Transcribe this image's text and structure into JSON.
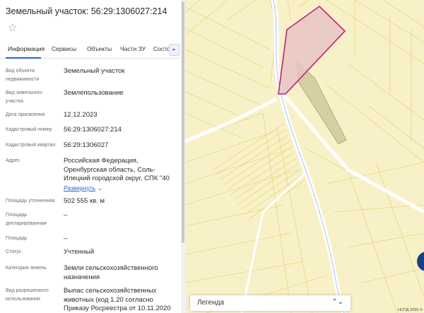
{
  "panel": {
    "title": "Земельный участок: 56:29:1306027:214",
    "star_icon": "☆",
    "tabs": [
      {
        "label": "Информация",
        "active": true
      },
      {
        "label": "Сервисы"
      },
      {
        "label": "Объекты"
      },
      {
        "label": "Части ЗУ"
      },
      {
        "label": "Состо"
      }
    ],
    "tab_scroll_icon": "▸",
    "rows": [
      {
        "label": "Вид объекта недвижимости",
        "value": "Земельный участок"
      },
      {
        "label": "Вид земельного участка",
        "value": "Землепользование"
      },
      {
        "label": "Дата присвоения",
        "value": "12.12.2023"
      },
      {
        "label": "Кадастровый номер",
        "value": "56:29:1306027:214"
      },
      {
        "label": "Кадастровый квартал",
        "value": "56:29:1306027"
      },
      {
        "label": "Адрес",
        "value": "Российская Федерация, Оренбургская область, Соль-Илецкий городской округ, СПК \"40",
        "link": "Развернуть"
      },
      {
        "label": "Площадь уточненная",
        "value": "502 555 кв. м"
      },
      {
        "label": "Площадь декларированная",
        "value": "–"
      },
      {
        "label": "Площадь",
        "value": "–"
      },
      {
        "label": "Статус",
        "value": "Учтенный"
      },
      {
        "label": "Категория земель",
        "value": "Земли сельскохозяйственного назначения"
      },
      {
        "label": "Вид разрешенного использования",
        "value": "Выпас сельскохозяйственных животных (код 1.20 согласно Приказу Росреестра от 10.11.2020 №"
      }
    ]
  },
  "map": {
    "legend_label": "Легенда",
    "legend_arrow": "⌃⌄",
    "copyright": "НСПД 2025 ©"
  },
  "colors": {
    "accent": "#2a63c8",
    "map_background": "#f8f1c8",
    "parcel_fill": "#e8c4c4",
    "parcel_stroke": "#b8237a"
  }
}
